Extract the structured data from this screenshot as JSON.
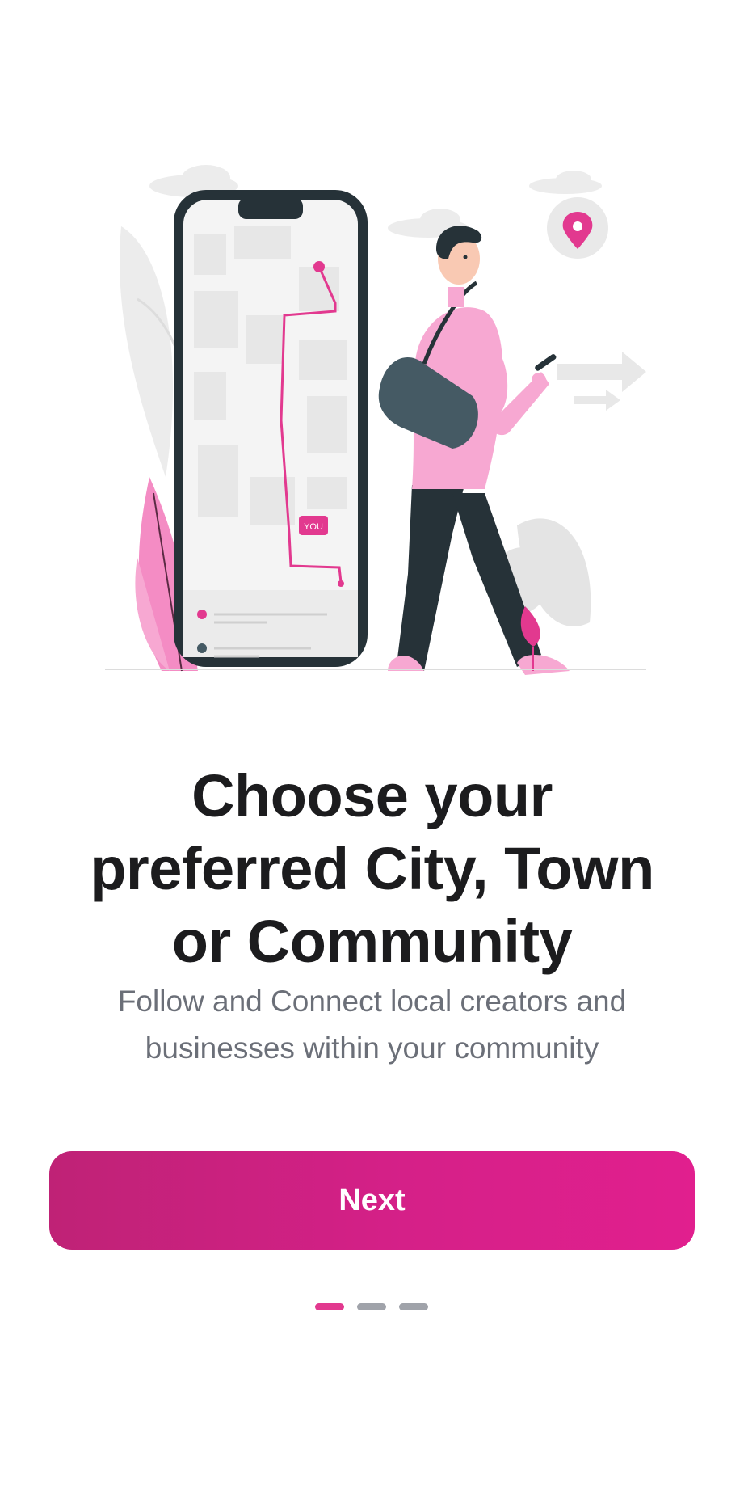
{
  "onboarding": {
    "illustration": {
      "description_icon": "map-navigation-illustration",
      "map_label": "YOU"
    },
    "title_lines": [
      "Choose your",
      "preferred City, Town",
      "or Community"
    ],
    "subtitle_lines": [
      "Follow and Connect local creators and",
      "businesses within your community"
    ],
    "next_label": "Next",
    "pager": {
      "count": 3,
      "active_index": 0
    }
  },
  "colors": {
    "accent": "#e11f8e",
    "accent_dark": "#bf2276",
    "title": "#1c1c1e",
    "subtitle": "#6b6f78",
    "dot_inactive": "#a0a3aa",
    "dot_active": "#e2398f"
  }
}
